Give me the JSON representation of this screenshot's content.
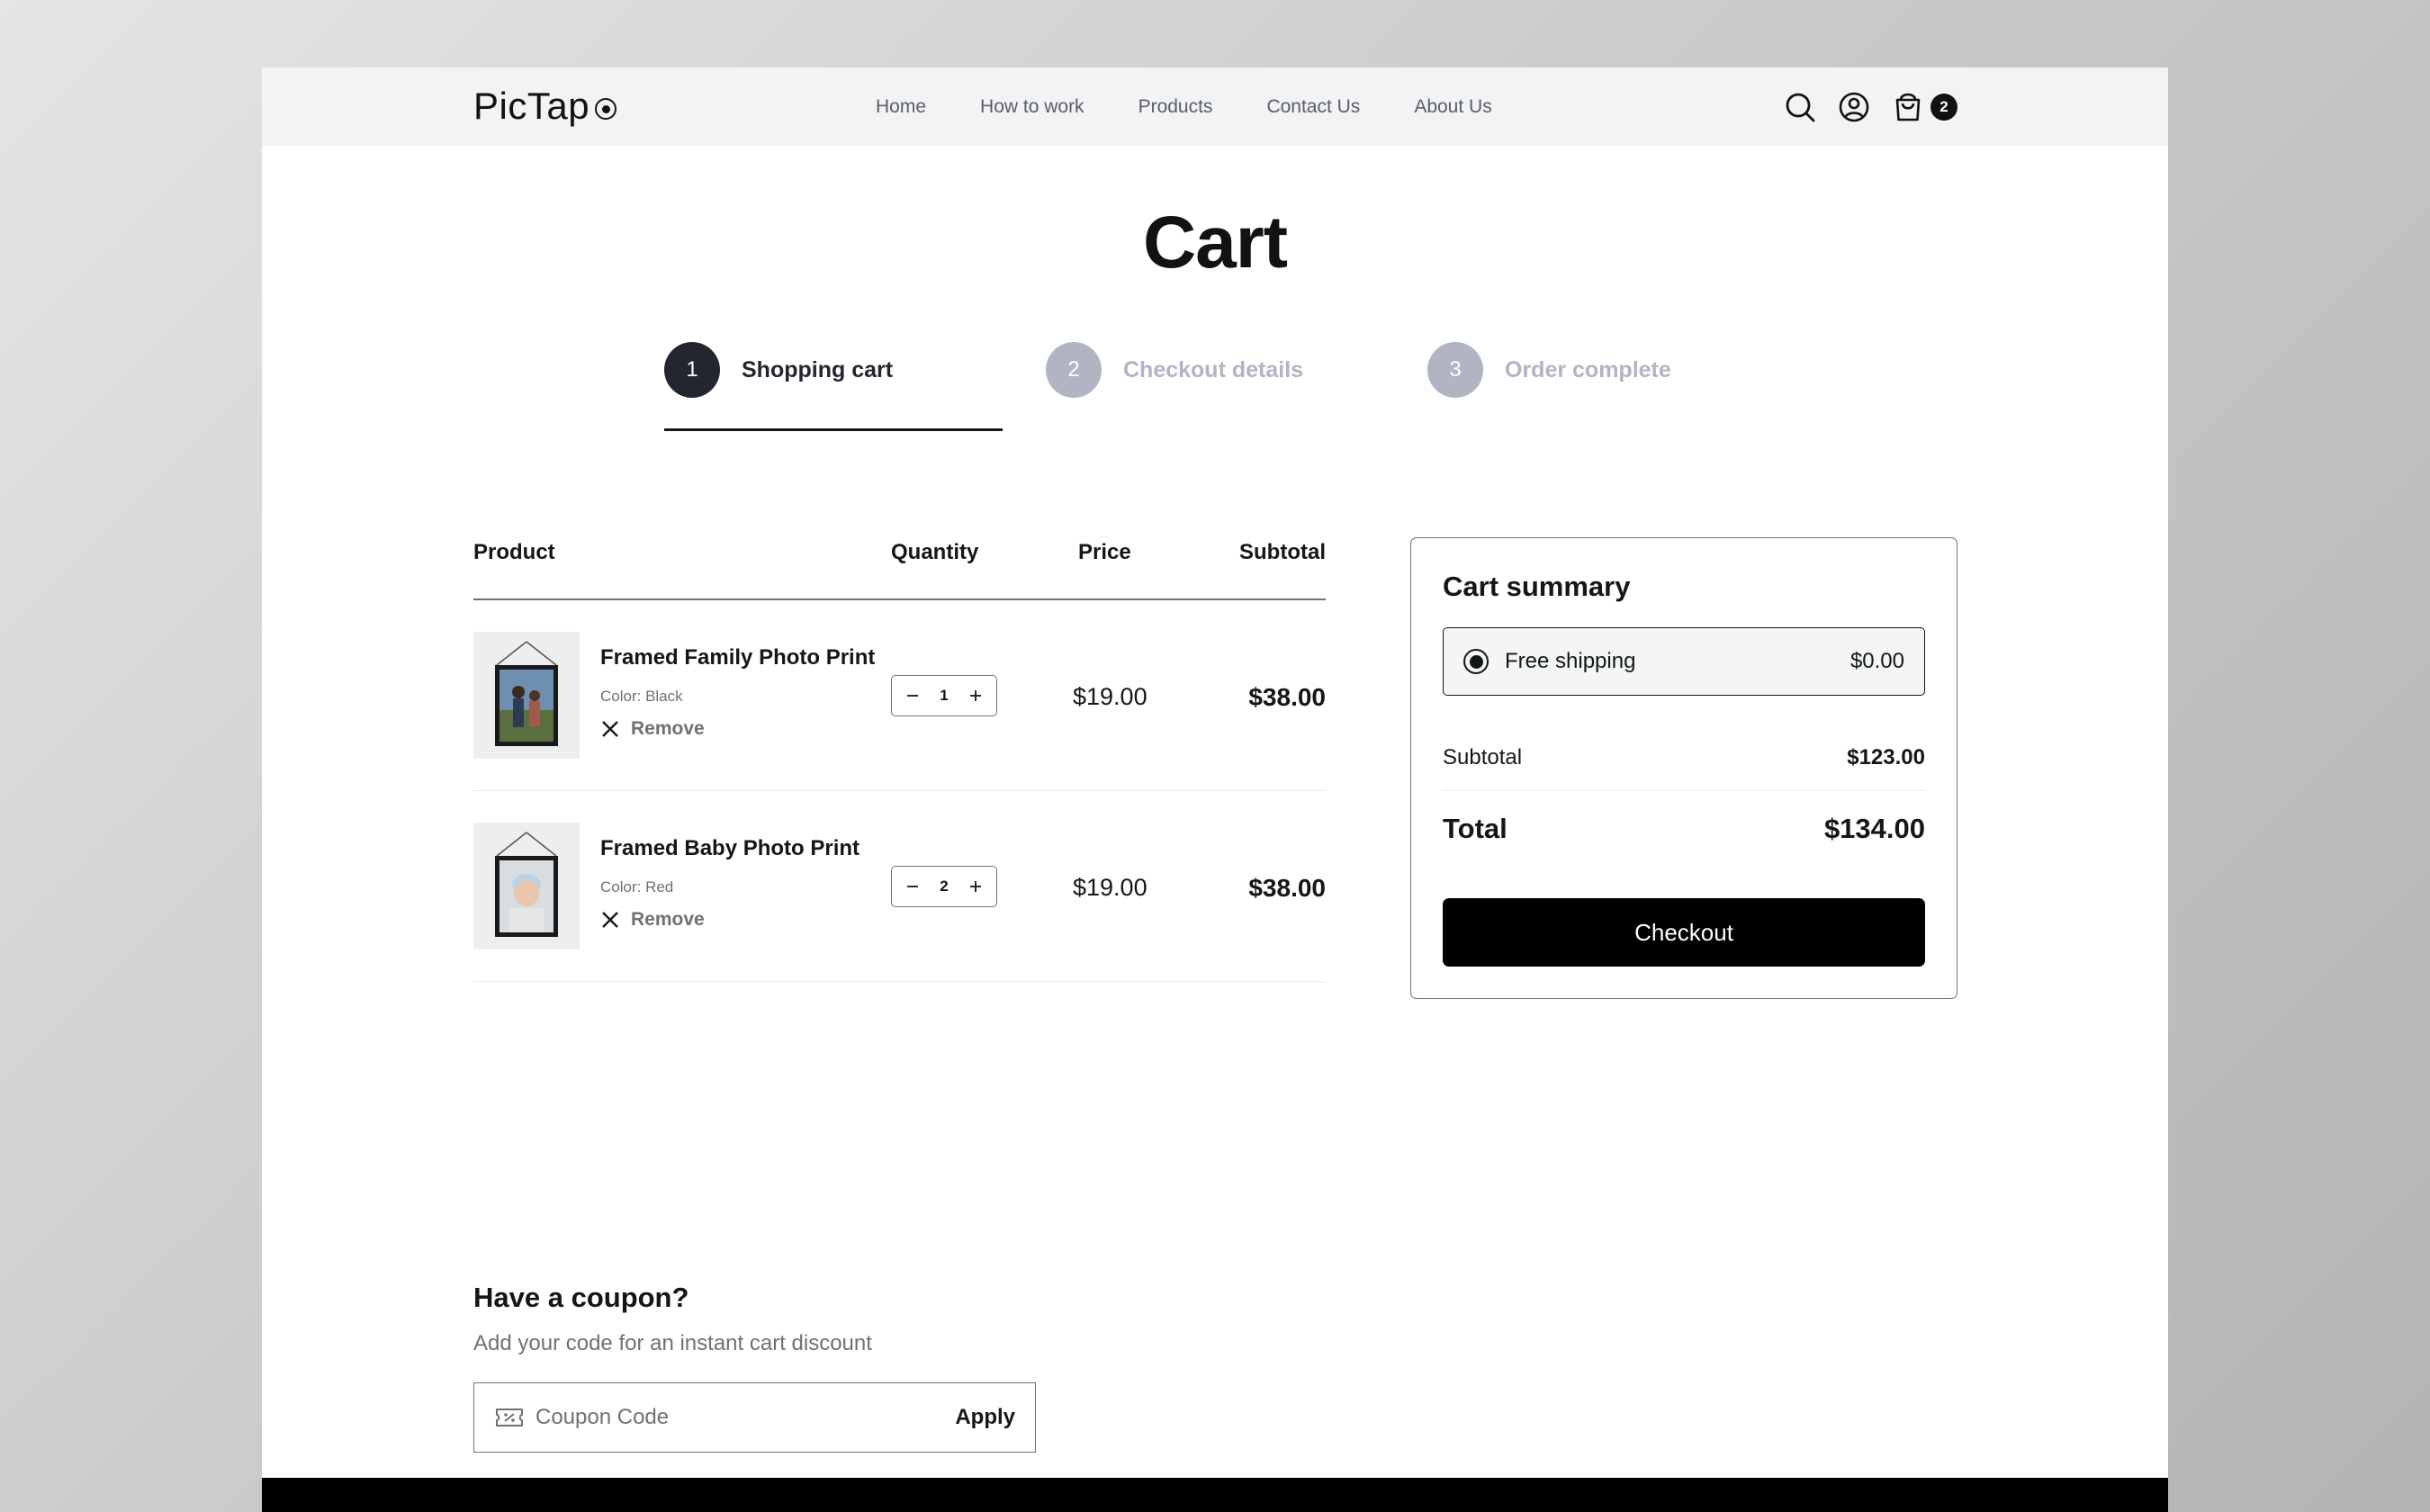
{
  "header": {
    "logo_text": "PicTap",
    "nav": [
      "Home",
      "How to work",
      "Products",
      "Contact Us",
      "About Us"
    ],
    "cart_count": "2"
  },
  "page_title": "Cart",
  "steps": [
    {
      "number": "1",
      "label": "Shopping cart",
      "state": "active"
    },
    {
      "number": "2",
      "label": "Checkout details",
      "state": "inactive"
    },
    {
      "number": "3",
      "label": "Order complete",
      "state": "inactive"
    }
  ],
  "table": {
    "headers": {
      "product": "Product",
      "quantity": "Quantity",
      "price": "Price",
      "subtotal": "Subtotal"
    },
    "items": [
      {
        "name": "Framed Family Photo Print",
        "color": "Color: Black",
        "remove": "Remove",
        "qty": "1",
        "price": "$19.00",
        "subtotal": "$38.00"
      },
      {
        "name": "Framed Baby Photo Print",
        "color": "Color: Red",
        "remove": "Remove",
        "qty": "2",
        "price": "$19.00",
        "subtotal": "$38.00"
      }
    ]
  },
  "summary": {
    "title": "Cart summary",
    "shipping_label": "Free shipping",
    "shipping_amount": "$0.00",
    "subtotal_label": "Subtotal",
    "subtotal_value": "$123.00",
    "total_label": "Total",
    "total_value": "$134.00",
    "checkout_label": "Checkout"
  },
  "coupon": {
    "title": "Have a coupon?",
    "subtitle": "Add your code for an instant cart discount",
    "placeholder": "Coupon Code",
    "apply_label": "Apply"
  },
  "colors": {
    "primary": "#000000",
    "text": "#141718",
    "muted": "#6c7275",
    "step_inactive": "#b1b5c3",
    "header_bg": "#f2f3f4"
  }
}
